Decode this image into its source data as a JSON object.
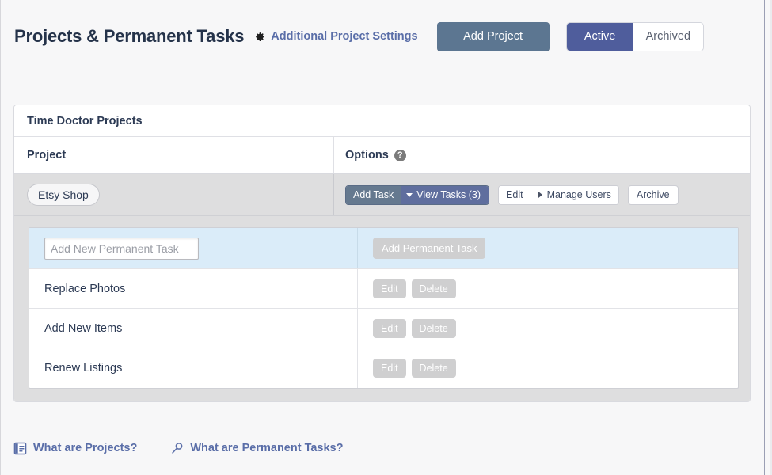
{
  "header": {
    "title": "Projects & Permanent Tasks",
    "settings_link": "Additional Project Settings",
    "gear_icon": "gear-icon",
    "add_project_label": "Add Project",
    "segmented": {
      "active_label": "Active",
      "archived_label": "Archived",
      "selected": "Active"
    }
  },
  "card": {
    "title": "Time Doctor Projects",
    "columns": {
      "project": "Project",
      "options": "Options",
      "options_help_icon": "help-circle-icon",
      "options_help_glyph": "?"
    },
    "project_row": {
      "name": "Etsy Shop",
      "actions": {
        "add_task": "Add Task",
        "view_tasks": "View Tasks (3)",
        "edit": "Edit",
        "manage_users": "Manage Users",
        "archive": "Archive"
      }
    },
    "permanent_tasks": {
      "add_row": {
        "input_placeholder": "Add New Permanent Task",
        "input_value": "",
        "add_button": "Add Permanent Task"
      },
      "row_actions": {
        "edit": "Edit",
        "delete": "Delete"
      },
      "items": [
        {
          "name": "Replace Photos"
        },
        {
          "name": "Add New Items"
        },
        {
          "name": "Renew Listings"
        }
      ]
    }
  },
  "footer": {
    "links": [
      {
        "label": "What are Projects?",
        "icon": "book-icon"
      },
      {
        "label": "What are Permanent Tasks?",
        "icon": "magnifier-icon"
      }
    ]
  },
  "colors": {
    "page_background": "#f7f7f8",
    "accent_link": "#5a6ea8",
    "add_project_button": "#5c7691",
    "active_segment": "#4f5d9c",
    "add_task_button": "#65798f",
    "view_tasks_button": "#5f6e9e",
    "row_gray": "#dededf",
    "add_row_blue": "#daecf9",
    "disabled_button": "#cfcfd0"
  }
}
